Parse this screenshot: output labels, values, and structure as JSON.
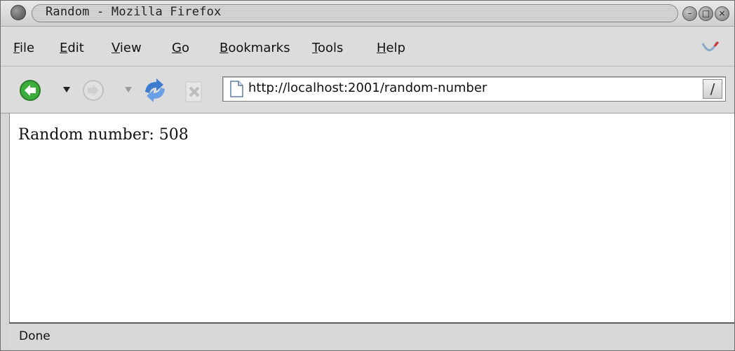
{
  "window": {
    "title": "Random - Mozilla Firefox"
  },
  "menubar": {
    "items": [
      {
        "label": "File"
      },
      {
        "label": "Edit"
      },
      {
        "label": "View"
      },
      {
        "label": "Go"
      },
      {
        "label": "Bookmarks"
      },
      {
        "label": "Tools"
      },
      {
        "label": "Help"
      }
    ]
  },
  "navbar": {
    "url": "http://localhost:2001/random-number",
    "go_glyph": "/"
  },
  "content": {
    "text": "Random number: 508"
  },
  "status": {
    "text": "Done"
  },
  "icons": {
    "back": "back-icon",
    "forward": "forward-icon",
    "reload": "reload-icon",
    "stop": "stop-icon",
    "page": "page-icon",
    "throbber": "throbber-icon"
  },
  "colors": {
    "back_green": "#3cae3c",
    "reload_blue": "#3d7bd1"
  }
}
